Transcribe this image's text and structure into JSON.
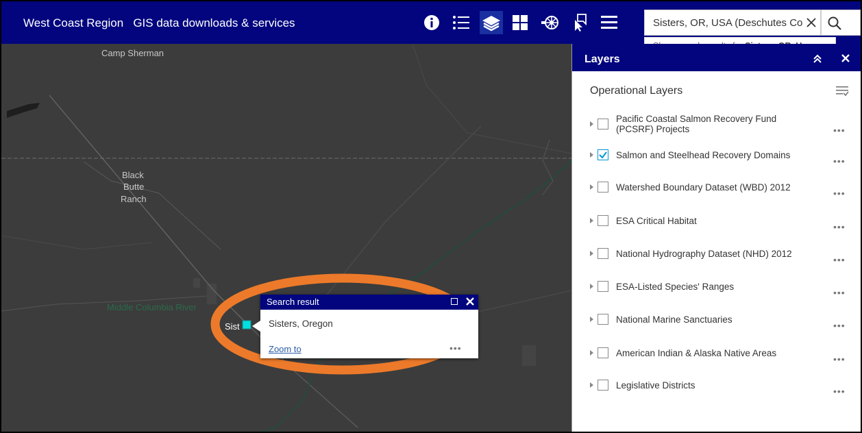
{
  "header": {
    "title": "West Coast Region   GIS data downloads & services",
    "search": {
      "value": "Sisters, OR, USA (Deschutes Co",
      "suggestion_prefix": "Show search results for ",
      "suggestion_bold": "Sisters, OR, U..."
    }
  },
  "map": {
    "labels": [
      {
        "text": "Camp Sherman"
      },
      {
        "text": "Black"
      },
      {
        "text": "Butte"
      },
      {
        "text": "Ranch"
      },
      {
        "text": "Middle Columbia River"
      },
      {
        "text": "Sist"
      }
    ],
    "colors": {
      "background": "#3c3c3c",
      "river": "#1f4e3d",
      "annotation": "#ec7a2a"
    }
  },
  "popup": {
    "title": "Search result",
    "name": "Sisters, Oregon",
    "zoom_link": "Zoom to",
    "more": "•••"
  },
  "layers_panel": {
    "title": "Layers",
    "section_title": "Operational Layers",
    "more": "•••",
    "layers": [
      {
        "label": "Pacific Coastal Salmon Recovery Fund (PCSRF) Projects",
        "checked": false
      },
      {
        "label": "Salmon and Steelhead Recovery Domains",
        "checked": true
      },
      {
        "label": "Watershed Boundary Dataset (WBD) 2012",
        "checked": false
      },
      {
        "label": "ESA Critical Habitat",
        "checked": false
      },
      {
        "label": "National Hydrography Dataset (NHD) 2012",
        "checked": false
      },
      {
        "label": "ESA-Listed Species' Ranges",
        "checked": false
      },
      {
        "label": "National Marine Sanctuaries",
        "checked": false
      },
      {
        "label": "American Indian & Alaska Native Areas",
        "checked": false
      },
      {
        "label": "Legislative Districts",
        "checked": false
      }
    ]
  },
  "icons": [
    "info-icon",
    "legend-icon",
    "layers-icon",
    "basemap-gallery-icon",
    "analysis-icon",
    "draw-icon",
    "menu-icon",
    "clear-icon",
    "search-icon",
    "collapse-icon",
    "close-icon",
    "filter-icon"
  ],
  "colors": {
    "header": "#02057e",
    "accent": "#0096d6",
    "annotation": "#ec7a2a"
  }
}
